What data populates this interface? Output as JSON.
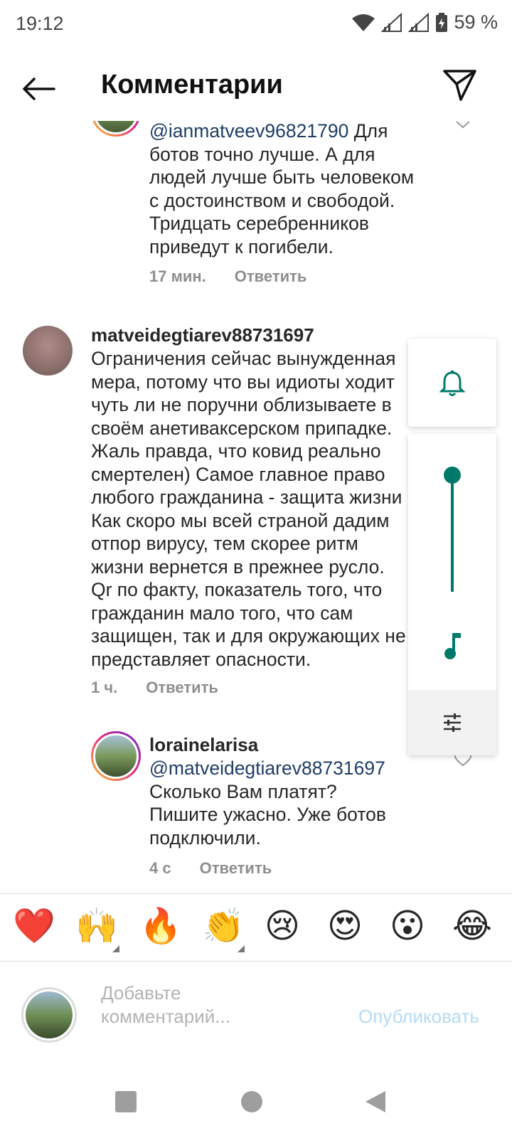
{
  "status_bar": {
    "time": "19:12",
    "battery": "59 %"
  },
  "header": {
    "title": "Комментарии"
  },
  "comments": [
    {
      "mention": "@ianmatveev96821790",
      "text_lines": [
        " Для",
        "ботов точно лучше. А для",
        "людей лучше быть человеком",
        "с достоинством и свободой.",
        "Тридцать серебренников",
        "приведут к погибели."
      ],
      "time": "17 мин.",
      "reply": "Ответить"
    },
    {
      "username": "matveidegtiarev88731697",
      "text_lines": [
        "Ограничения сейчас вынужденная",
        "мера, потому что вы идиоты ходит",
        "чуть ли не поручни облизываете в",
        "своём анетиваксерском припадке.",
        "Жаль правда, что ковид реально",
        "смертелен) Самое главное право",
        "любого гражданина - защита жизни",
        "Как скоро мы всей страной дадим",
        "отпор вирусу, тем скорее ритм",
        "жизни вернется в прежнее русло.",
        "Qr по факту, показатель того, что",
        "гражданин мало того, что сам",
        "защищен, так и для окружающих не",
        "представляет опасности."
      ],
      "time": "1 ч.",
      "reply": "Ответить"
    },
    {
      "username": "lorainelarisa",
      "mention": "@matveidegtiarev88731697",
      "text_lines": [
        "Сколько Вам платят?",
        "Пишите ужасно. Уже ботов",
        "подключили."
      ],
      "time": "4 с",
      "reply": "Ответить"
    }
  ],
  "reactions": [
    "❤️",
    "🙌",
    "🔥",
    "👏",
    "😢",
    "😍",
    "😮",
    "😂"
  ],
  "composer": {
    "placeholder_line1": "Добавьте",
    "placeholder_line2": "комментарий...",
    "publish": "Опубликовать"
  },
  "volume": {
    "level": 1.0,
    "accent": "#00796b"
  },
  "colors": {
    "mention": "#1e3d66",
    "publish": "#b3dbf6",
    "meta": "#8e8e8e"
  }
}
